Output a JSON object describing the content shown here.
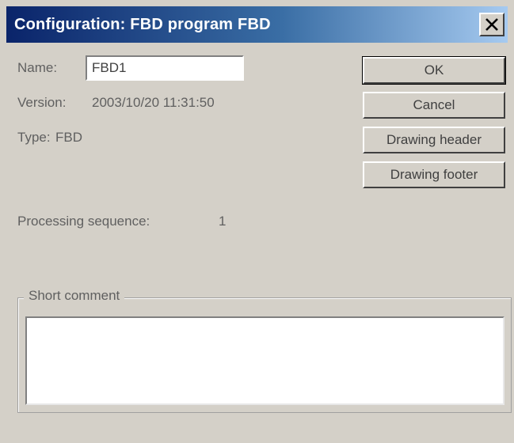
{
  "window": {
    "title": "Configuration: FBD program FBD"
  },
  "form": {
    "name_label": "Name:",
    "name_value": "FBD1",
    "version_label": "Version:",
    "version_value": "2003/10/20 11:31:50",
    "type_label": "Type:",
    "type_value": "FBD",
    "processing_label": "Processing sequence:",
    "processing_value": "1"
  },
  "buttons": {
    "ok": "OK",
    "cancel": "Cancel",
    "drawing_header": "Drawing header",
    "drawing_footer": "Drawing footer"
  },
  "comment": {
    "legend": "Short comment",
    "value": ""
  },
  "icons": {
    "close": "close-icon"
  },
  "colors": {
    "title_gradient_start": "#0a246a",
    "title_gradient_end": "#a6caf0",
    "dialog_background": "#d4d0c8"
  }
}
